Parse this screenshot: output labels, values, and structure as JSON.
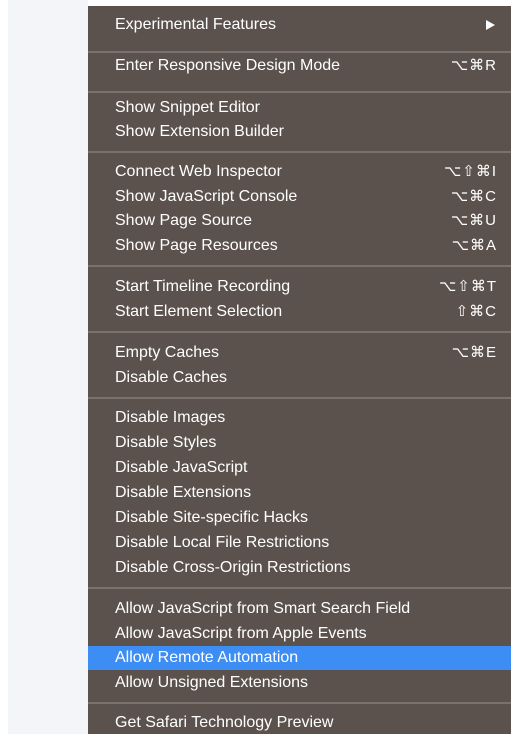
{
  "menu": {
    "items": [
      {
        "label": "Experimental Features",
        "shortcut": ""
      },
      {
        "label": "Enter Responsive Design Mode",
        "shortcut": "⌥⌘R"
      },
      {
        "label": "Show Snippet Editor",
        "shortcut": ""
      },
      {
        "label": "Show Extension Builder",
        "shortcut": ""
      },
      {
        "label": "Connect Web Inspector",
        "shortcut": "⌥⇧⌘I"
      },
      {
        "label": "Show JavaScript Console",
        "shortcut": "⌥⌘C"
      },
      {
        "label": "Show Page Source",
        "shortcut": "⌥⌘U"
      },
      {
        "label": "Show Page Resources",
        "shortcut": "⌥⌘A"
      },
      {
        "label": "Start Timeline Recording",
        "shortcut": "⌥⇧⌘T"
      },
      {
        "label": "Start Element Selection",
        "shortcut": "⇧⌘C"
      },
      {
        "label": "Empty Caches",
        "shortcut": "⌥⌘E"
      },
      {
        "label": "Disable Caches",
        "shortcut": ""
      },
      {
        "label": "Disable Images",
        "shortcut": ""
      },
      {
        "label": "Disable Styles",
        "shortcut": ""
      },
      {
        "label": "Disable JavaScript",
        "shortcut": ""
      },
      {
        "label": "Disable Extensions",
        "shortcut": ""
      },
      {
        "label": "Disable Site-specific Hacks",
        "shortcut": ""
      },
      {
        "label": "Disable Local File Restrictions",
        "shortcut": ""
      },
      {
        "label": "Disable Cross-Origin Restrictions",
        "shortcut": ""
      },
      {
        "label": "Allow JavaScript from Smart Search Field",
        "shortcut": ""
      },
      {
        "label": "Allow JavaScript from Apple Events",
        "shortcut": ""
      },
      {
        "label": "Allow Remote Automation",
        "shortcut": ""
      },
      {
        "label": "Allow Unsigned Extensions",
        "shortcut": ""
      },
      {
        "label": "Get Safari Technology Preview",
        "shortcut": ""
      }
    ],
    "selected_item": "Allow Remote Automation",
    "submenu_icon": "submenu-arrow-icon"
  },
  "colors": {
    "menu_background": "#5c524d",
    "selection": "#3d8ef4",
    "separator": "#7a716c",
    "text": "#ffffff"
  }
}
